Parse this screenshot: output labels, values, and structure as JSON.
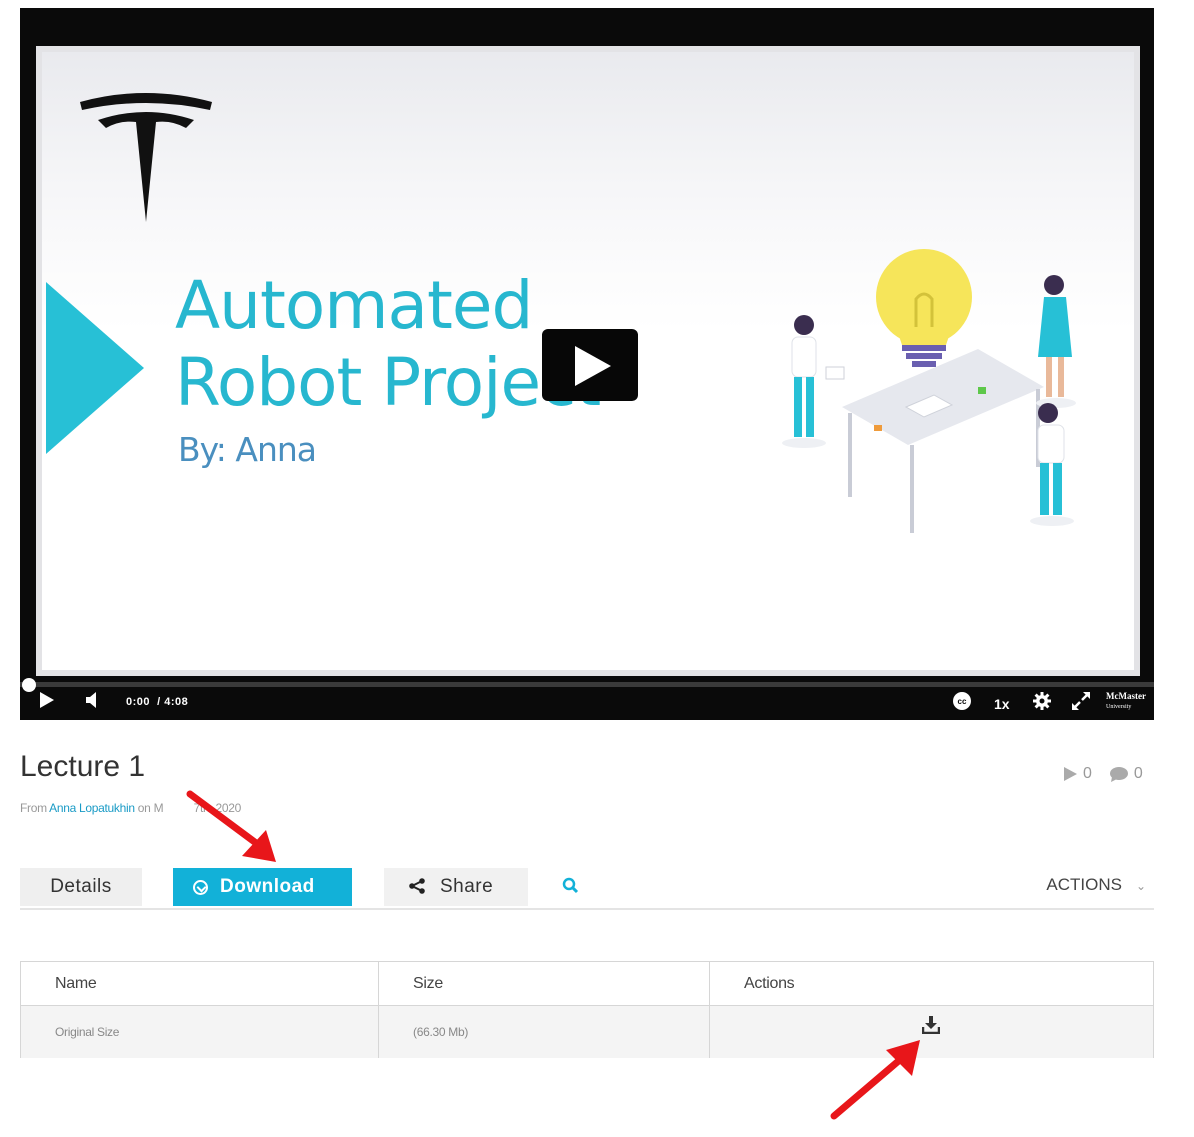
{
  "player": {
    "slide": {
      "title_line1": "Automated",
      "title_line2": "Robot Project",
      "byline": "By: Anna",
      "accent_color": "#27b7cf"
    },
    "controls": {
      "time_current": "0:00",
      "time_total": "/ 4:08",
      "speed": "1x",
      "brand": "McMaster",
      "brand_sub": "University",
      "progress": 0
    }
  },
  "media": {
    "title": "Lecture 1",
    "from_label": "From",
    "author": "Anna Lopatukhin",
    "on_label": "on",
    "date_partial": "M",
    "date_tail": "7th, 2020",
    "plays": "0",
    "comments": "0"
  },
  "tabs": {
    "details": "Details",
    "download": "Download",
    "share": "Share",
    "actions": "ACTIONS"
  },
  "table": {
    "headers": [
      "Name",
      "Size",
      "Actions"
    ],
    "rows": [
      {
        "name": "Original Size",
        "size": "(66.30 Mb)"
      }
    ]
  },
  "colors": {
    "download_tab": "#12b1d8",
    "annotation_arrow": "#e8161a",
    "link": "#1a9bc6"
  },
  "icons": [
    "tesla-logo-icon",
    "play-icon",
    "volume-icon",
    "closed-captions-icon",
    "gear-icon",
    "fullscreen-icon",
    "share-icon",
    "search-icon",
    "download-icon",
    "chevron-down-icon",
    "comment-icon"
  ]
}
